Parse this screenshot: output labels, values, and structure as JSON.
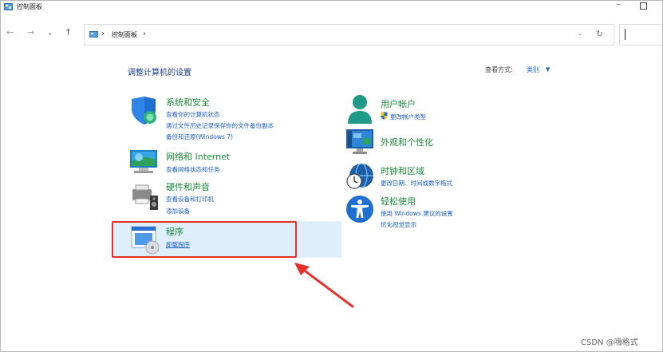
{
  "window": {
    "title": "控制面板"
  },
  "address": {
    "crumb": "控制面板",
    "separator": "›"
  },
  "main": {
    "heading": "调整计算机的设置",
    "view_by_label": "查看方式:",
    "view_by_value": "类别",
    "left_categories": [
      {
        "title": "系统和安全",
        "links": [
          "查看你的计算机状态",
          "通过文件历史记录保存你的文件备份副本",
          "备份和还原(Windows 7)"
        ]
      },
      {
        "title": "网络和 Internet",
        "links": [
          "查看网络状态和任务"
        ]
      },
      {
        "title": "硬件和声音",
        "links": [
          "查看设备和打印机",
          "添加设备"
        ]
      },
      {
        "title": "程序",
        "links": [
          "卸载程序"
        ]
      }
    ],
    "right_categories": [
      {
        "title": "用户帐户",
        "links": [
          "更改帐户类型"
        ]
      },
      {
        "title": "外观和个性化",
        "links": []
      },
      {
        "title": "时钟和区域",
        "links": [
          "更改日期、时间或数字格式"
        ]
      },
      {
        "title": "轻松使用",
        "links": [
          "使用 Windows 建议的设置",
          "优化视觉显示"
        ]
      }
    ]
  },
  "watermark": "CSDN @嗨格式",
  "colors": {
    "category_title": "#1a8c3a",
    "link": "#1c5fd1",
    "heading": "#1c3f91",
    "highlight_box": "#e4322b",
    "highlight_bg": "#dfeefb"
  },
  "icons": [
    "control-panel-icon",
    "back-arrow-icon",
    "forward-arrow-icon",
    "chevron-down-icon",
    "up-arrow-icon",
    "refresh-icon",
    "shield-icon",
    "network-icon",
    "printer-icon",
    "programs-icon",
    "user-icon",
    "uac-shield-icon",
    "monitor-icon",
    "clock-globe-icon",
    "accessibility-icon",
    "red-arrow-icon"
  ]
}
